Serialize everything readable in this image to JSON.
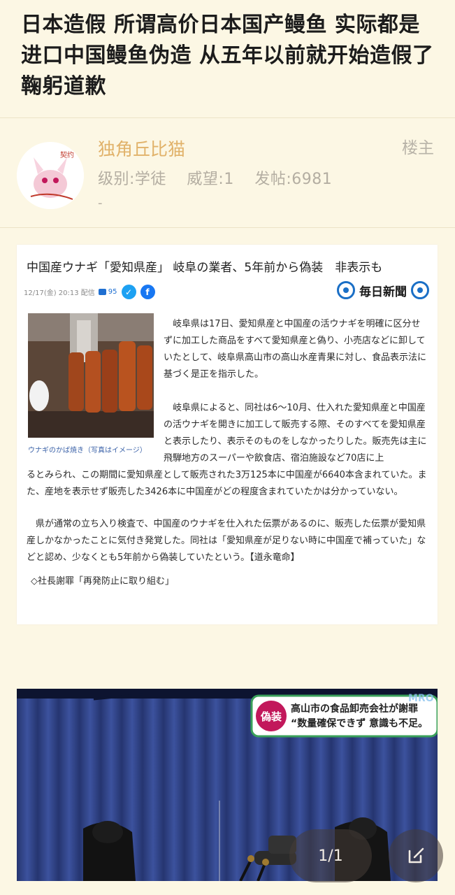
{
  "post": {
    "title": "日本造假 所谓高价日本国产鳗鱼 实际都是进口中国鳗鱼伪造 从五年以前就开始造假了 鞠躬道歉"
  },
  "author": {
    "name": "独角丘比猫",
    "role": "楼主",
    "level": "级别:学徒",
    "prestige": "威望:1",
    "posts": "发帖:6981",
    "extra": "-",
    "avatar_text": "契约"
  },
  "news": {
    "headline": "中国産ウナギ「愛知県産」 岐阜の業者、5年前から偽装　非表示も",
    "datetime": "12/17(金) 20:13 配信",
    "comment_count": "95",
    "source": "毎日新聞",
    "photo_caption": "ウナギのかば焼き（写真はイメージ）",
    "para1": "　岐阜県は17日、愛知県産と中国産の活ウナギを明確に区分せずに加工した商品をすべて愛知県産と偽り、小売店などに卸していたとして、岐阜県高山市の高山水産青果に対し、食品表示法に基づく是正を指示した。",
    "para2": "　岐阜県によると、同社は6～10月、仕入れた愛知県産と中国産の活ウナギを開きに加工して販売する際、そのすべてを愛知県産と表示したり、表示そのものをしなかったりした。販売先は主に飛騨地方のスーパーや飲食店、宿泊施設など70店に上",
    "para2b": "るとみられ、この期間に愛知県産として販売された3万125本に中国産が6640本含まれていた。また、産地を表示せず販売した3426本に中国産がどの程度含まれていたかは分かっていない。",
    "para3": "　県が通常の立ち入り検査で、中国産のウナギを仕入れた伝票があるのに、販売した伝票が愛知県産しかなかったことに気付き発覚した。同社は「愛知県産が足りない時に中国産で補っていた」などと認め、少なくとも5年前から偽装していたという。【道永竜命】",
    "para4": "◇社長謝罪「再発防止に取り組む」"
  },
  "tv": {
    "badge": "偽装",
    "line1": "高山市の食品卸売会社が謝罪",
    "line2": "“数量確保できず 意識も不足。",
    "watermark": "MRO"
  },
  "viewer": {
    "page_indicator": "1/1"
  }
}
